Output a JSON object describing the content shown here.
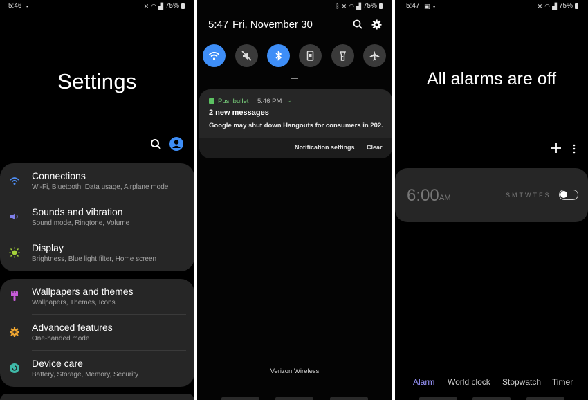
{
  "settings_screen": {
    "status": {
      "time": "5:46",
      "battery": "75%"
    },
    "title": "Settings",
    "groups": [
      {
        "items": [
          {
            "label": "Connections",
            "sub": "Wi-Fi, Bluetooth, Data usage, Airplane mode",
            "icon": "wifi-icon",
            "color": "#4f8ff7"
          },
          {
            "label": "Sounds and vibration",
            "sub": "Sound mode, Ringtone, Volume",
            "icon": "volume-icon",
            "color": "#7f7fe8"
          },
          {
            "label": "Display",
            "sub": "Brightness, Blue light filter, Home screen",
            "icon": "sun-icon",
            "color": "#a5d23a"
          }
        ]
      },
      {
        "items": [
          {
            "label": "Wallpapers and themes",
            "sub": "Wallpapers, Themes, Icons",
            "icon": "brush-icon",
            "color": "#c65bd8"
          },
          {
            "label": "Advanced features",
            "sub": "One-handed mode",
            "icon": "gear-plus-icon",
            "color": "#f0a630"
          },
          {
            "label": "Device care",
            "sub": "Battery, Storage, Memory, Security",
            "icon": "device-care-icon",
            "color": "#3fb9a8"
          }
        ]
      }
    ]
  },
  "shade_screen": {
    "status": {
      "battery": "75%"
    },
    "time": "5:47",
    "date": "Fri, November 30",
    "quick_toggles": [
      {
        "name": "wifi",
        "on": true
      },
      {
        "name": "sound-mute",
        "on": false
      },
      {
        "name": "bluetooth",
        "on": true
      },
      {
        "name": "auto-rotate",
        "on": false
      },
      {
        "name": "flashlight",
        "on": false
      },
      {
        "name": "airplane",
        "on": false
      }
    ],
    "notification": {
      "app": "Pushbullet",
      "time": "5:46 PM",
      "title": "2 new messages",
      "body": "Google may shut down Hangouts for consumers in 202...",
      "settings_label": "Notification settings",
      "clear_label": "Clear"
    },
    "carrier": "Verizon Wireless"
  },
  "alarm_screen": {
    "status": {
      "time": "5:47",
      "battery": "75%"
    },
    "title": "All alarms are off",
    "alarm": {
      "time": "6:00",
      "ampm": "AM",
      "days": "SMTWTFS",
      "enabled": false
    },
    "tabs": [
      {
        "label": "Alarm",
        "active": true
      },
      {
        "label": "World clock",
        "active": false
      },
      {
        "label": "Stopwatch",
        "active": false
      },
      {
        "label": "Timer",
        "active": false
      }
    ]
  }
}
